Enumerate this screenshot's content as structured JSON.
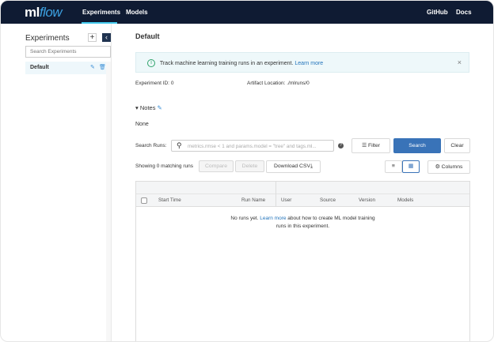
{
  "nav": {
    "logo_ml": "ml",
    "logo_flow": "flow",
    "links": [
      "Experiments",
      "Models"
    ],
    "right_links": [
      "GitHub",
      "Docs"
    ]
  },
  "sidebar": {
    "title": "Experiments",
    "add": "+",
    "collapse": "‹",
    "search_placeholder": "Search Experiments",
    "items": [
      {
        "label": "Default"
      }
    ]
  },
  "main": {
    "title": "Default",
    "banner": {
      "text": "Track machine learning training runs in an experiment.",
      "link": "Learn more",
      "close": "×",
      "icon": "info-icon"
    },
    "experiment_id_label": "Experiment ID:",
    "experiment_id": "0",
    "artifact_label": "Artifact Location:",
    "artifact": "./mlruns/0",
    "notes_label": "Notes",
    "notes_value": "None",
    "search_label": "Search Runs:",
    "search_placeholder": "metrics.rmse < 1 and params.model = \"tree\" and tags.ml...",
    "filter": "Filter",
    "search": "Search",
    "clear": "Clear",
    "showing": "Showing 0 matching runs",
    "compare": "Compare",
    "delete": "Delete",
    "download": "Download CSV",
    "columns": "Columns",
    "table_headers": [
      "Start Time",
      "Run Name",
      "User",
      "Source",
      "Version",
      "Models"
    ],
    "empty_pre": "No runs yet.",
    "empty_link": "Learn more",
    "empty_post": "about how to create ML model training",
    "empty_line2": "runs in this experiment.",
    "accent": "#3973b8",
    "nav_bg": "#0f1b33"
  }
}
